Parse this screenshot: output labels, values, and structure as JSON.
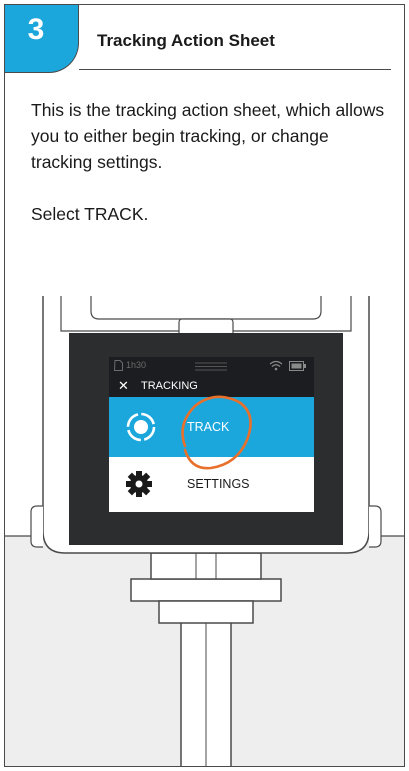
{
  "header": {
    "step_number": "3",
    "title": "Tracking Action Sheet"
  },
  "instructions": {
    "paragraph1": "This is the tracking action sheet, which allows you to either begin tracking, or change tracking settings.",
    "paragraph2": "Select TRACK."
  },
  "device_screen": {
    "status_bar": {
      "time_label": "1h30"
    },
    "title": "TRACKING",
    "menu": [
      {
        "label": "TRACK",
        "icon": "target-icon",
        "highlighted": true
      },
      {
        "label": "SETTINGS",
        "icon": "gear-icon",
        "highlighted": false
      }
    ]
  },
  "colors": {
    "accent": "#1ca7dc",
    "highlight_ring": "#e8702a",
    "screen_dark": "#1b1d20",
    "bezel": "#2b2d2f",
    "outline": "#4a4a4a"
  }
}
